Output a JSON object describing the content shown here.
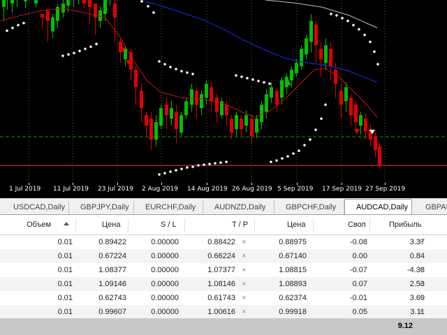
{
  "colors": {
    "background": "#000000",
    "bull_candle": "#00c000",
    "bear_candle": "#e00000",
    "ma_slow": "#1428c8",
    "ma_mid": "#c81414",
    "ma_long": "#c0c0c0",
    "parabolic_sar": "#ffffff",
    "bid_line": "#ff4040",
    "ask_line": "#00a000",
    "grid": "#000000"
  },
  "date_axis": [
    "1 Jul 2019",
    "11 Jul 2019",
    "23 Jul 2019",
    "2 Aug 2019",
    "14 Aug 2019",
    "26 Aug 2019",
    "5 Sep 2019",
    "17 Sep 2019",
    "27 Sep 2019"
  ],
  "tabs": [
    {
      "label": "USDCAD,Daily",
      "active": false
    },
    {
      "label": "GBPJPY,Daily",
      "active": false
    },
    {
      "label": "EURCHF,Daily",
      "active": false
    },
    {
      "label": "AUDNZD,Daily",
      "active": false
    },
    {
      "label": "GBPCHF,Daily",
      "active": false
    },
    {
      "label": "AUDCAD,Daily",
      "active": true
    },
    {
      "label": "GBPAU",
      "active": false
    }
  ],
  "table": {
    "headers": {
      "volume": "Объем",
      "price": "Цена",
      "sl": "S / L",
      "tp": "T / P",
      "current_price": "Цена",
      "swap": "Своп",
      "profit": "Прибыль"
    },
    "rows": [
      {
        "volume": "0.01",
        "price": "0.89422",
        "sl": "0.00000",
        "tp": "0.88422",
        "current_price": "0.88975",
        "swap": "-0.08",
        "profit": "3.37"
      },
      {
        "volume": "0.01",
        "price": "0.67224",
        "sl": "0.00000",
        "tp": "0.66224",
        "current_price": "0.67140",
        "swap": "0.00",
        "profit": "0.84"
      },
      {
        "volume": "0.01",
        "price": "1.08377",
        "sl": "0.00000",
        "tp": "1.07377",
        "current_price": "1.08815",
        "swap": "-0.07",
        "profit": "-4.38"
      },
      {
        "volume": "0.01",
        "price": "1.09146",
        "sl": "0.00000",
        "tp": "1.08146",
        "current_price": "1.08893",
        "swap": "0.07",
        "profit": "2.53"
      },
      {
        "volume": "0.01",
        "price": "0.62743",
        "sl": "0.00000",
        "tp": "0.61743",
        "current_price": "0.62374",
        "swap": "-0.01",
        "profit": "3.69"
      },
      {
        "volume": "0.01",
        "price": "0.99607",
        "sl": "0.00000",
        "tp": "1.00616",
        "current_price": "0.99918",
        "swap": "0.05",
        "profit": "3.11"
      }
    ],
    "total_profit": "9.12",
    "close_icon": "close-icon",
    "sort_icon": "sort-ascending-icon"
  }
}
